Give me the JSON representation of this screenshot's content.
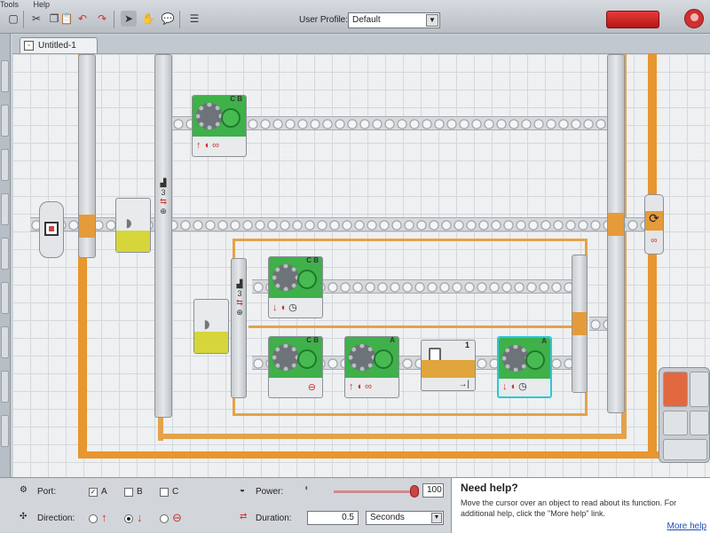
{
  "menu": {
    "items": [
      "Tools",
      "Help"
    ]
  },
  "toolbar": {
    "user_profile_label": "User Profile:",
    "user_profile_value": "Default",
    "icons": [
      "cut-icon",
      "copy-icon",
      "paste-icon",
      "undo-icon",
      "redo-icon",
      "pointer-icon",
      "pan-icon",
      "comment-icon",
      "custom-palette-icon"
    ]
  },
  "document": {
    "tab_title": "Untitled-1"
  },
  "program": {
    "outer_switch": {
      "port": "3"
    },
    "inner_switch": {
      "port": "3"
    },
    "top_motor": {
      "ports": "C B"
    },
    "middle_motor": {
      "ports": "C B"
    },
    "bottom_motor_1": {
      "ports": "C B"
    },
    "bottom_motor_2": {
      "ports": "A"
    },
    "wait_block": {
      "number": "1"
    },
    "bottom_motor_3": {
      "ports": "A"
    }
  },
  "config_panel": {
    "port_label": "Port:",
    "port_options": [
      {
        "label": "A",
        "checked": true
      },
      {
        "label": "B",
        "checked": false
      },
      {
        "label": "C",
        "checked": false
      }
    ],
    "direction_label": "Direction:",
    "power_label": "Power:",
    "power_value": "100",
    "duration_label": "Duration:",
    "duration_value": "0.5",
    "duration_unit": "Seconds"
  },
  "help": {
    "title": "Need help?",
    "body": "Move the cursor over an object to read about its function. For additional help, click the \"More help\" link.",
    "link": "More help"
  },
  "colors": {
    "wire": "#e8962e",
    "motor": "#3fb04a",
    "selected": "#2cc7d9"
  }
}
